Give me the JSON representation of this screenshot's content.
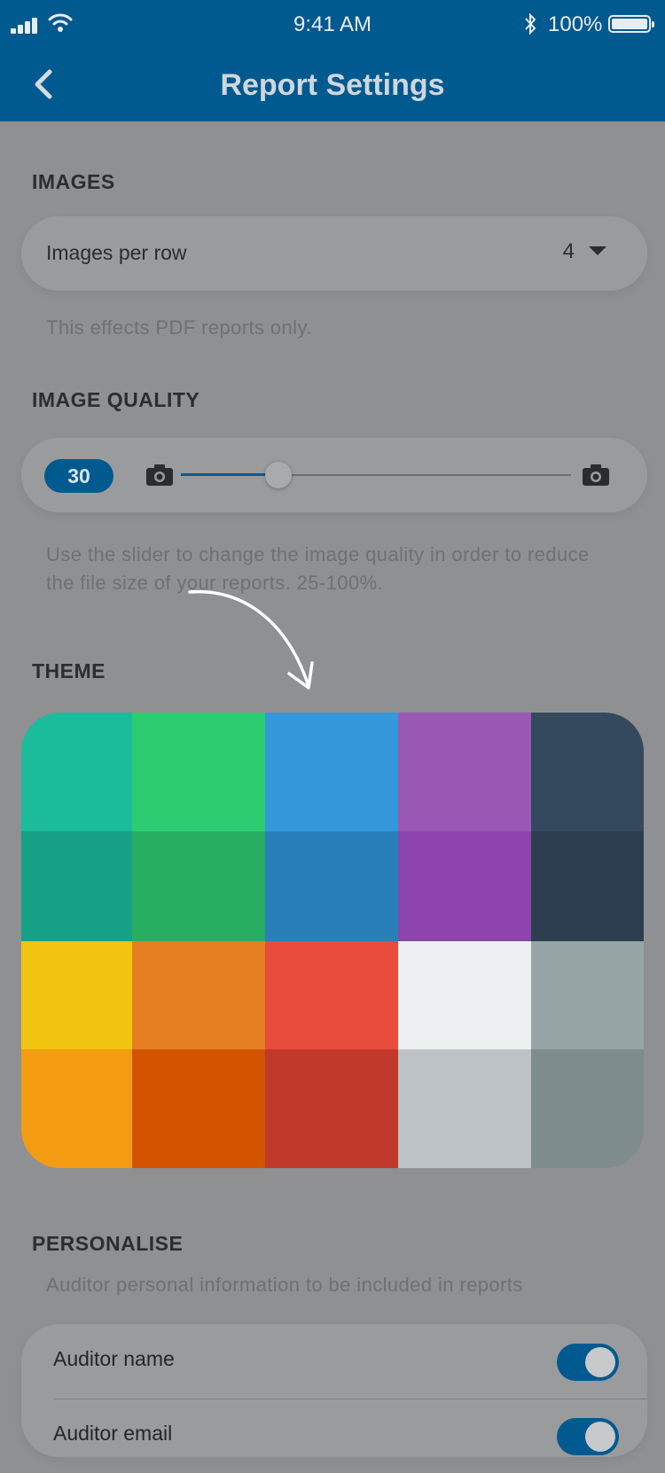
{
  "status_bar": {
    "time": "9:41 AM",
    "battery": "100%",
    "icons": [
      "signal-icon",
      "wifi-icon",
      "bluetooth-icon",
      "battery-icon"
    ]
  },
  "nav": {
    "title": "Report Settings",
    "back_icon": "chevron-left-icon"
  },
  "images": {
    "section_title": "IMAGES",
    "row_label": "Images per row",
    "value": "4",
    "helper": "This effects PDF reports only."
  },
  "image_quality": {
    "section_title": "IMAGE QUALITY",
    "value": "30",
    "slider_fraction": 0.25,
    "range": [
      25,
      100
    ],
    "helper": "Use the slider to change the image quality in order to reduce the file size of your reports. 25-100%."
  },
  "theme": {
    "section_title": "THEME",
    "swatches": [
      "#1abc9c",
      "#2ecc71",
      "#3498db",
      "#9b59b6",
      "#34495e",
      "#16a085",
      "#27ae60",
      "#2980b9",
      "#8e44ad",
      "#2c3e50",
      "#f1c40f",
      "#e67e22",
      "#e74c3c",
      "#ecf0f1",
      "#95a5a6",
      "#f39c12",
      "#d35400",
      "#c0392b",
      "#bdc3c7",
      "#7f8c8d"
    ]
  },
  "personalise": {
    "section_title": "PERSONALISE",
    "helper": "Auditor personal information to be included in reports",
    "toggles": [
      {
        "label": "Auditor name",
        "on": true
      },
      {
        "label": "Auditor email",
        "on": true
      }
    ]
  },
  "colors": {
    "brand": "#005a8f",
    "overlay_bg": "#8f9091"
  }
}
